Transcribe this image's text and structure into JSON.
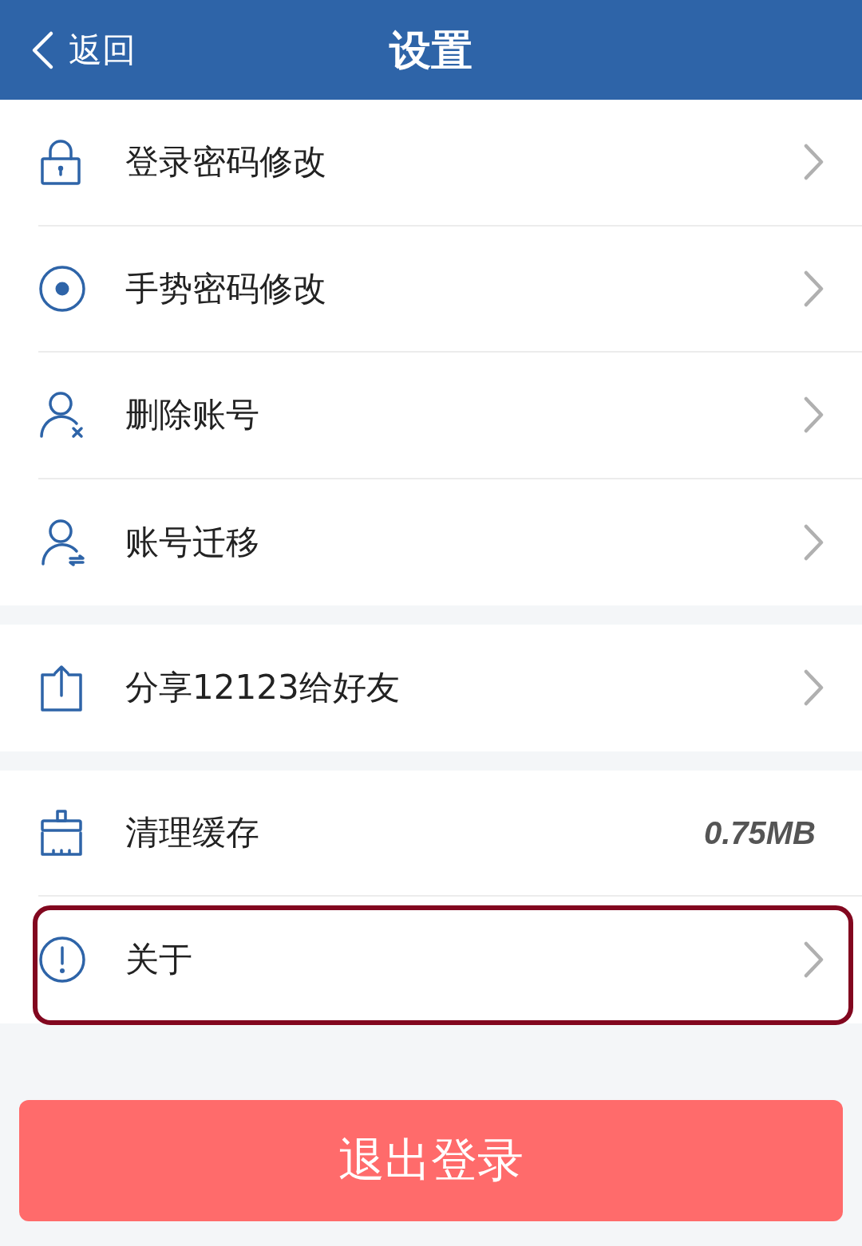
{
  "header": {
    "back": {
      "label": "返回"
    },
    "title": "设置"
  },
  "groups": [
    {
      "items": [
        {
          "kind": "lock",
          "label": "登录密码修改",
          "highlighted": false
        },
        {
          "kind": "gesture",
          "label": "手势密码修改",
          "highlighted": false
        },
        {
          "kind": "user-remove",
          "label": "删除账号",
          "highlighted": false
        },
        {
          "kind": "user-transfer",
          "label": "账号迁移",
          "highlighted": false
        }
      ]
    },
    {
      "items": [
        {
          "kind": "share",
          "label": "分享12123给好友",
          "highlighted": false
        }
      ]
    },
    {
      "items": [
        {
          "kind": "brush",
          "label": "清理缓存",
          "value": "0.75MB",
          "highlighted": false
        },
        {
          "kind": "info",
          "label": "关于",
          "highlighted": true
        }
      ]
    }
  ],
  "logout_button": {
    "label": "退出登录"
  }
}
